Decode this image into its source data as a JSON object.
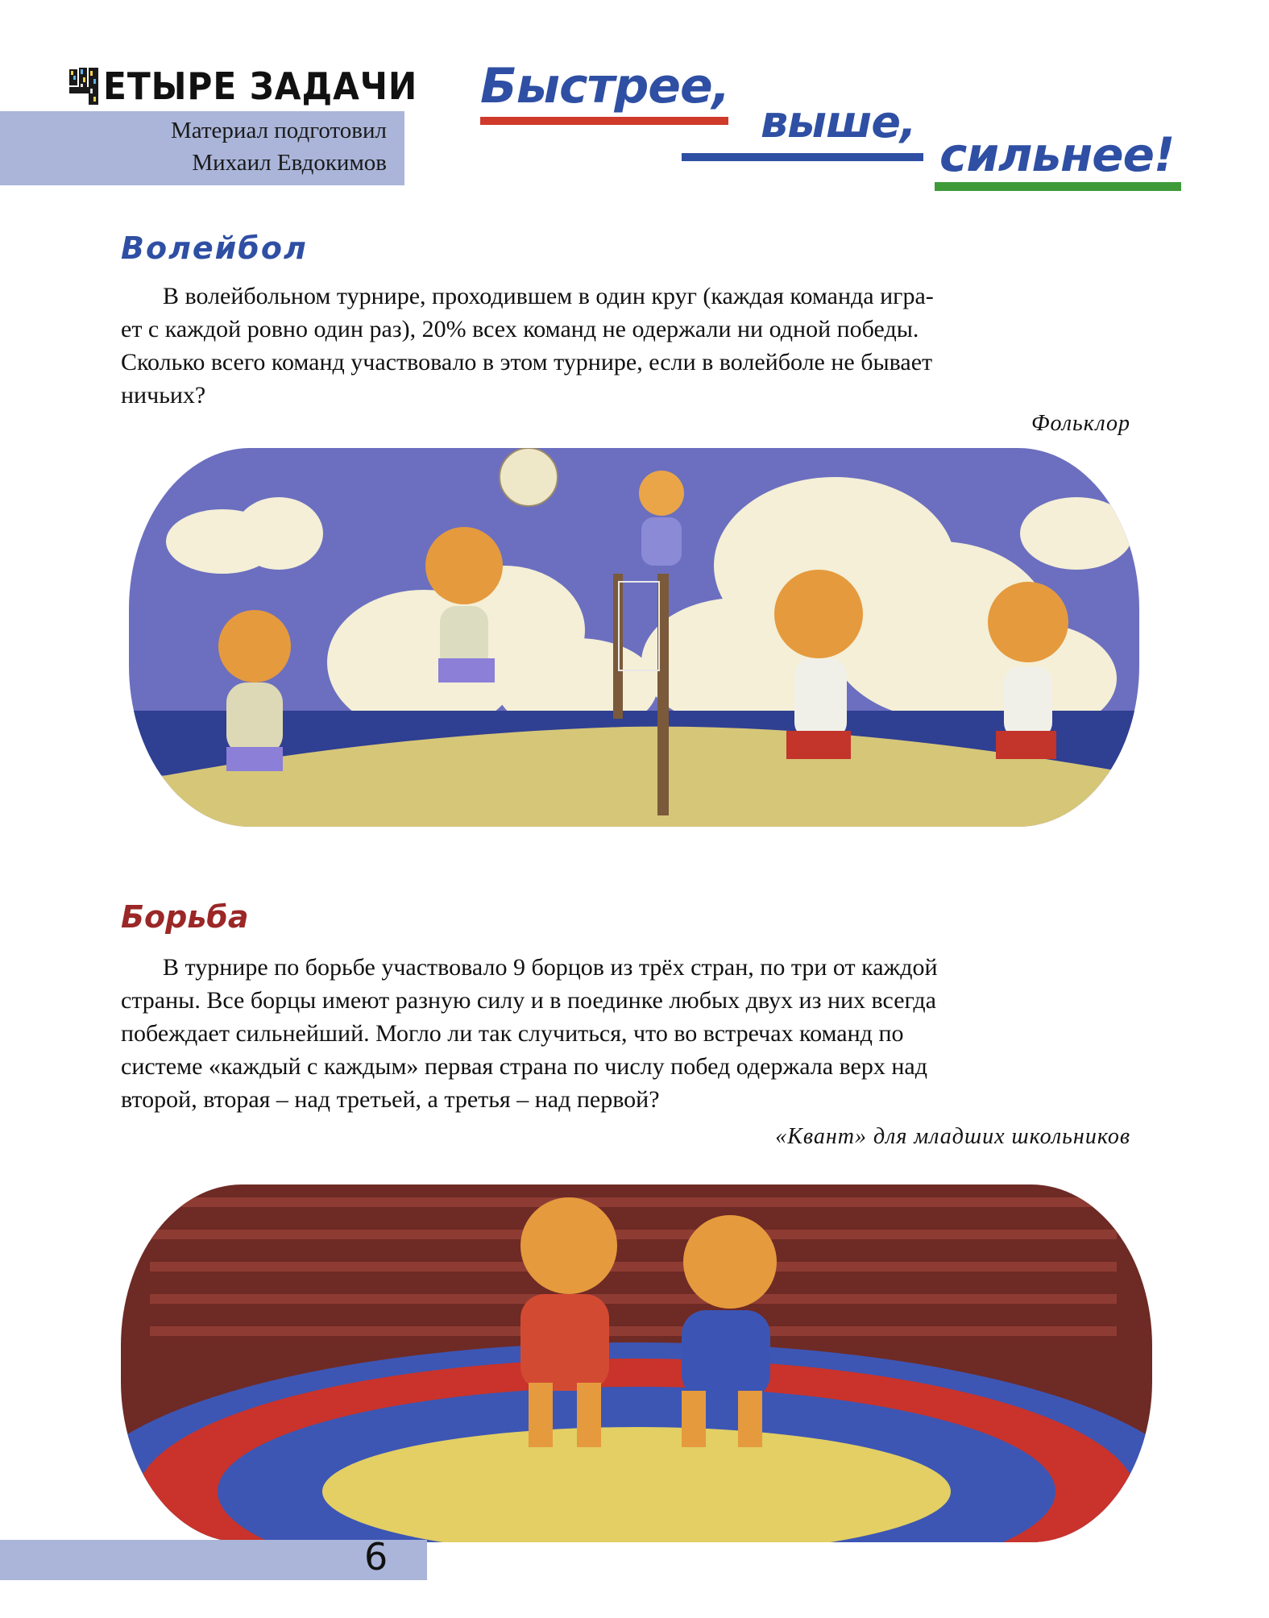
{
  "header": {
    "section_title": "ЧЕТЫРЕ ЗАДАЧИ",
    "section_title_text": "ЕТЫРЕ ЗАДАЧИ",
    "author_line1": "Материал подготовил",
    "author_line2": "Михаил Евдокимов"
  },
  "slogan": {
    "part1": "Быстрее,",
    "part2": "выше,",
    "part3": "сильнее!"
  },
  "problems": [
    {
      "title": "Волейбол",
      "lines": [
        "В волейбольном турнире, проходившем в один круг (каждая команда игра-",
        "ет с каждой ровно один раз), 20% всех команд не одержали ни одной победы.",
        "Сколько всего команд участвовало в этом турнире, если в волейболе не бывает",
        "ничьих?"
      ],
      "source": "Фольклор"
    },
    {
      "title": "Борьба",
      "lines": [
        "В турнире по борьбе участвовало 9 борцов из трёх стран, по три от каждой",
        "страны. Все борцы имеют разную силу и в поединке любых двух из них всегда",
        "побеждает сильнейший. Могло ли так случиться, что во встречах команд по",
        "системе «каждый с каждым» первая страна по числу побед одержала верх над",
        "второй, вторая – над третьей, а третья – над первой?"
      ],
      "source": "«Квант» для младших школьников"
    }
  ],
  "footer": {
    "page_number": "6"
  },
  "colors": {
    "blue": "#2e4fa3",
    "red": "#cf3a2b",
    "green": "#3f9a3a",
    "dark_red": "#9b2727",
    "band": "#aab5d9"
  }
}
